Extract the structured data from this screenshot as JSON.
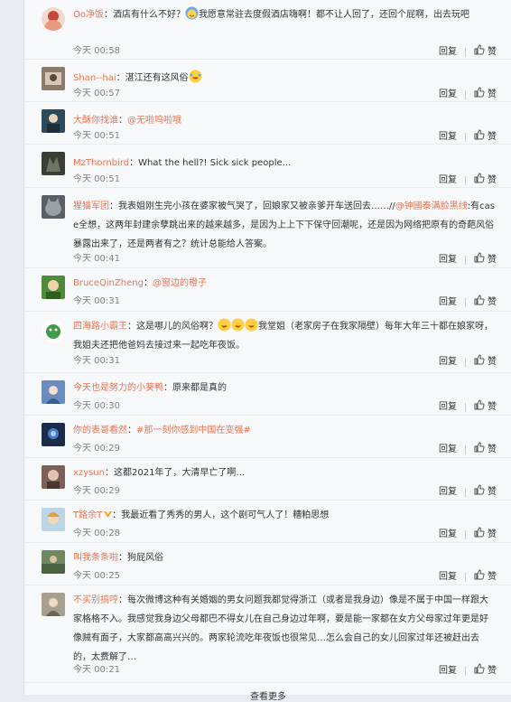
{
  "labels": {
    "reply": "回复",
    "like": "赞",
    "more": "查看更多"
  },
  "comments": [
    {
      "user": "Oo净饭",
      "sep": "：",
      "text1": "酒店有什么不好？",
      "text2": "我愿意常驻去度假酒店嗨啊！都不让人回了，还回个屁啊，出去玩吧",
      "time": "今天 00:58",
      "emoji": "smile-sweat"
    },
    {
      "user": "Shan--hai",
      "sep": "：",
      "text1": "湛江还有这风俗",
      "time": "今天 00:57",
      "emoji": "tear-laugh"
    },
    {
      "user": "大酥你找谁",
      "sep": "：",
      "mention": "@无啦呜啦哦",
      "time": "今天 00:51"
    },
    {
      "user": "MzThornbird",
      "sep": "：",
      "text1": "What the hell?! Sick sick people...",
      "time": "今天 00:51"
    },
    {
      "user": "猩猫军团",
      "sep": "：",
      "text1": "我表姐刚生完小孩在婆家被气哭了，回娘家又被亲爹开车送回去……//",
      "mention": "@钟國泰满脸黑线",
      "text2": ":有case全想，这两年封建余孽跳出来的越来越多，是因为上上下下保守回潮呢，还是因为网络把原有的奇葩风俗暴露出来了，还是两者有之？统计总能给人答案。",
      "time": "今天 00:41"
    },
    {
      "user": "BruceQinZheng",
      "sep": "：",
      "mention": "@窗边的橙子",
      "time": "今天 00:31"
    },
    {
      "user": "四海路小霸王",
      "sep": "：",
      "text1": "这是哪儿的风俗啊？",
      "text2": "我堂姐（老家房子在我家隔壁）每年大年三十都在娘家呀，我姐夫还把他爸妈去接过来一起吃年夜饭。",
      "time": "今天 00:31"
    },
    {
      "user": "今天也是努力的小葵鸭",
      "sep": "：",
      "text1": "原来都是真的",
      "time": "今天 00:30"
    },
    {
      "user": "你的表哥看然",
      "sep": "：",
      "mention": "#那一刻你感到中国在变强#",
      "time": "今天 00:29"
    },
    {
      "user": "xzysun",
      "sep": "：",
      "text1": "这都2021年了，大清早亡了啊…",
      "time": "今天 00:29"
    },
    {
      "user": "T路余T",
      "sep": "：",
      "text1": "我最近看了秀秀的男人，这个剧可气人了！糟粕思想",
      "time": "今天 00:28"
    },
    {
      "user": "叫我条条啦",
      "sep": "：",
      "text1": "狗屁风俗",
      "time": "今天 00:25"
    },
    {
      "user": "不买别搞哼",
      "sep": "：",
      "text1": "每次微博这种有关婚姻的男女问题我都觉得浙江（或者是我身边）像是不属于中国一样跟大家格格不入。我感觉我身边父母都巴不得女儿在自己身边过年啊，要是能一家都在女方父母家过年更是好像贼有面子，大家都高高兴兴的。两家轮流吃年夜饭也很常见…怎么会自己的女儿回家过年还被赶出去的，太费解了…",
      "time": "今天 00:21"
    }
  ],
  "colors": {
    "username": "#eb7350",
    "text": "#333333",
    "meta": "#808080",
    "panel": "#f7f8fa",
    "page": "#e8edf2"
  }
}
